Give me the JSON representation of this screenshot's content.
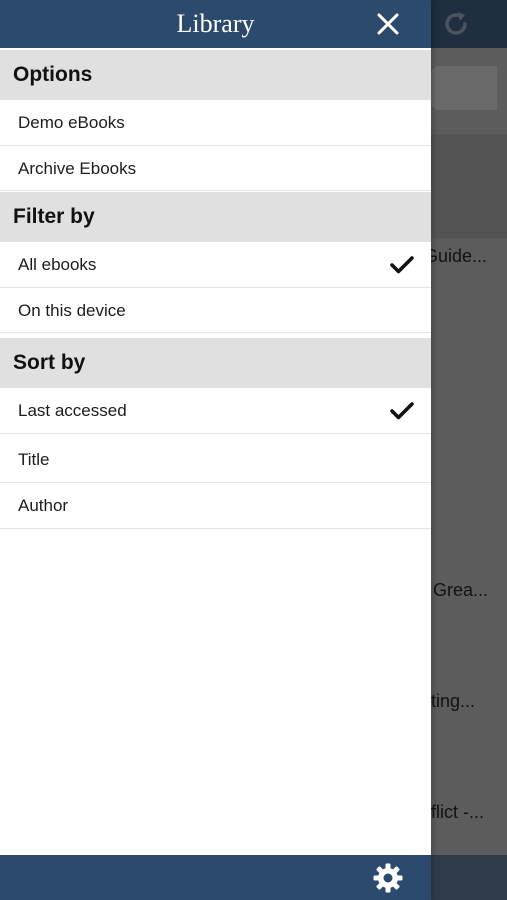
{
  "drawer": {
    "title": "Library",
    "sections": [
      {
        "header": "Options",
        "items": [
          {
            "label": "Demo eBooks",
            "checked": false
          },
          {
            "label": "Archive Ebooks",
            "checked": false
          }
        ]
      },
      {
        "header": "Filter by",
        "items": [
          {
            "label": "All ebooks",
            "checked": true
          },
          {
            "label": "On this device",
            "checked": false
          }
        ]
      },
      {
        "header": "Sort by",
        "items": [
          {
            "label": "Last accessed",
            "checked": true
          },
          {
            "label": "Title",
            "checked": false
          },
          {
            "label": "Author",
            "checked": false
          }
        ]
      }
    ]
  },
  "background": {
    "rows": [
      "Guide...",
      "Grea...",
      "ting...",
      "flict -..."
    ]
  },
  "colors": {
    "drawer_header": "#2b4a6e",
    "section_header_bg": "#e0e0e0",
    "dim_overlay": "#5c5c5c"
  },
  "icons": {
    "close": "close-icon",
    "check": "checkmark-icon",
    "settings": "gear-icon",
    "refresh": "refresh-icon"
  }
}
